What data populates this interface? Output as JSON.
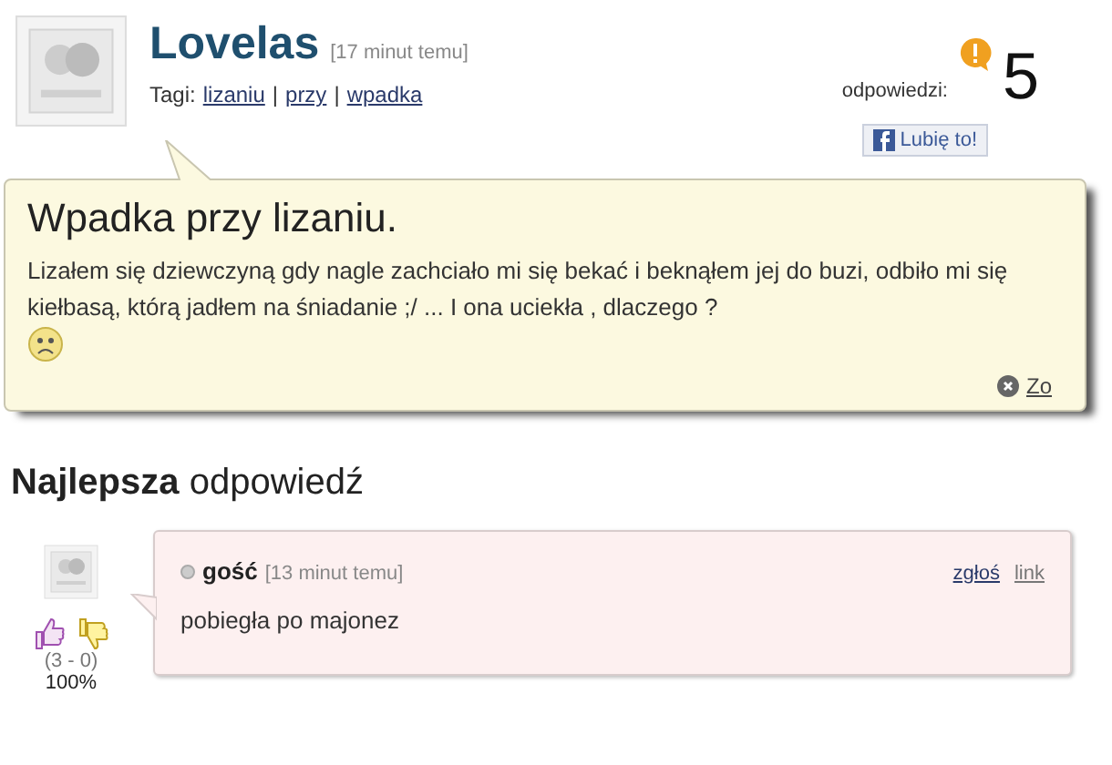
{
  "question": {
    "author": "Lovelas",
    "time": "[17 minut temu]",
    "tags_label": "Tagi:",
    "tags": [
      {
        "kind": "link",
        "text": "lizaniu"
      },
      {
        "kind": "separator",
        "text": "|"
      },
      {
        "kind": "link",
        "text": "przy"
      },
      {
        "kind": "separator",
        "text": "|"
      },
      {
        "kind": "link",
        "text": "wpadka"
      }
    ],
    "answers_label": "odpowiedzi:",
    "answers_count": "5",
    "like_button": "Lubię to!",
    "title": "Wpadka przy lizaniu.",
    "body": "Lizałem się dziewczyną gdy nagle zachciało mi się bekać i beknąłem jej do buzi, odbiło mi się kiełbasą, którą jadłem na śniadanie ;/ ... I ona uciekła , dlaczego ?",
    "close_link": "Zo"
  },
  "best_answer": {
    "heading": "**Najlepsza** odpowiedź",
    "author": "gość",
    "time": "[13 minut temu]",
    "links": [
      "zgłoś",
      "link"
    ],
    "text": "pobiegła po majonez",
    "votes": "(3 - 0)",
    "percent": "100%"
  }
}
